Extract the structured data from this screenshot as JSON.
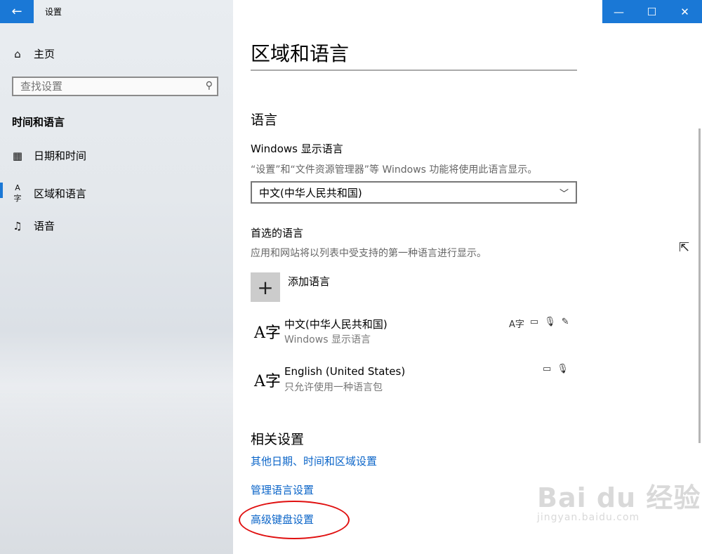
{
  "window": {
    "app_title": "设置",
    "back_icon": "←",
    "minimize_icon": "—",
    "maximize_icon": "☐",
    "close_icon": "✕"
  },
  "sidebar": {
    "home": {
      "icon": "⌂",
      "label": "主页"
    },
    "search": {
      "placeholder": "查找设置",
      "icon": "⚲"
    },
    "group_heading": "时间和语言",
    "items": [
      {
        "icon": "▦",
        "label": "日期和时间"
      },
      {
        "icon": "A字",
        "label": "区域和语言",
        "selected": true
      },
      {
        "icon": "♫",
        "label": "语音"
      }
    ]
  },
  "main": {
    "page_title": "区域和语言",
    "language_section": {
      "heading": "语言",
      "display_language_label": "Windows 显示语言",
      "display_language_desc": "“设置”和“文件资源管理器”等 Windows 功能将使用此语言显示。",
      "display_language_value": "中文(中华人民共和国)",
      "dropdown_icon": "﹀",
      "preferred_label": "首选的语言",
      "preferred_desc": "应用和网站将以列表中受支持的第一种语言进行显示。",
      "add_language_icon": "+",
      "add_language_label": "添加语言",
      "languages": [
        {
          "icon": "A字",
          "name": "中文(中华人民共和国)",
          "sub": "Windows 显示语言",
          "features": [
            "A字",
            "▭",
            "🎙",
            "✎"
          ]
        },
        {
          "icon": "A字",
          "name": "English (United States)",
          "sub": "只允许使用一种语言包",
          "features": [
            "▭",
            "🎙"
          ]
        }
      ]
    },
    "related_section": {
      "heading": "相关设置",
      "links": [
        "其他日期、时间和区域设置",
        "管理语言设置",
        "高级键盘设置"
      ]
    }
  },
  "overlay": {
    "cursor_icon": "⇱",
    "watermark_main": "Bai du 经验",
    "watermark_sub": "jingyan.baidu.com",
    "highlight_color": "#e01010"
  },
  "colors": {
    "accent": "#1a78d6",
    "link": "#0a64c8"
  }
}
